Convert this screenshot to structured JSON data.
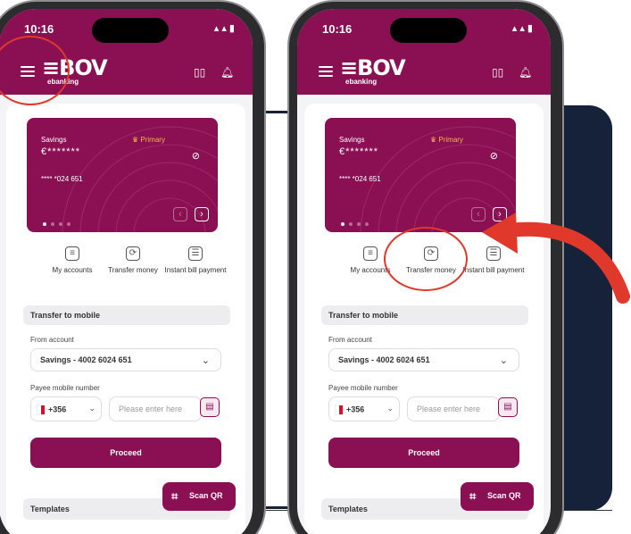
{
  "status_bar": {
    "time": "10:16",
    "icons": "▴ ▴ ▮"
  },
  "header": {
    "logo_main": "≡BOV",
    "logo_sub": "ebanking"
  },
  "card": {
    "type": "Savings",
    "badge": "Primary",
    "balance": "€*******",
    "number": "**** *024 651",
    "pager": {
      "total": 4,
      "active": 1
    }
  },
  "actions": [
    {
      "label": "My accounts",
      "icon": "list-icon"
    },
    {
      "label": "Transfer money",
      "icon": "transfer-icon"
    },
    {
      "label": "Instant bill payment",
      "icon": "bill-icon"
    }
  ],
  "transfer": {
    "title": "Transfer to mobile",
    "from_label": "From account",
    "from_value": "Savings - 4002 6024 651",
    "payee_label": "Payee mobile number",
    "country_code": "+356",
    "phone_placeholder": "Please enter here",
    "proceed_label": "Proceed"
  },
  "templates_label": "Templates",
  "scanqr_label": "Scan QR",
  "colors": {
    "brand": "#8a1053",
    "annotation": "#e0382b",
    "navy": "#16213a"
  }
}
